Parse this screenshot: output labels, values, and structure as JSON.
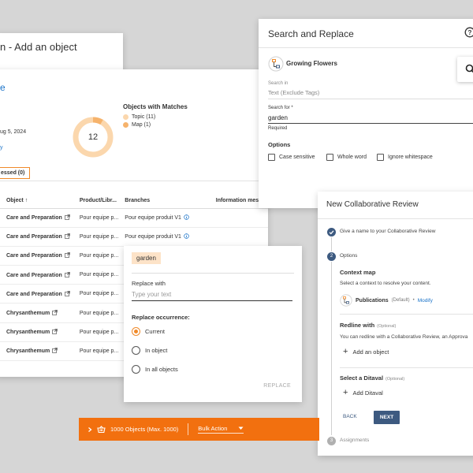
{
  "add_panel": {
    "title": "n - Add an object"
  },
  "table_panel": {
    "crumb": "e",
    "date": "ug 5, 2024",
    "link": "y",
    "objects_with_matches": {
      "title": "Objects with Matches",
      "total": "12",
      "items": [
        {
          "label": "Topic (11)",
          "color": "#fbd7ad",
          "value": 11
        },
        {
          "label": "Map (1)",
          "color": "#f6b36c",
          "value": 1
        }
      ]
    },
    "tab_label": "essed (0)",
    "columns": [
      "Object",
      "Product/Libr...",
      "Branches",
      "Information messa"
    ],
    "rows": [
      {
        "object": "Care and Preparation",
        "product": "Pour equipe p...",
        "branch": "Pour equipe produit V1"
      },
      {
        "object": "Care and Preparation",
        "product": "Pour equipe p...",
        "branch": "Pour equipe produit V1"
      },
      {
        "object": "Care and Preparation",
        "product": "Pour equipe p...",
        "branch": ""
      },
      {
        "object": "Care and Preparation",
        "product": "Pour equipe p...",
        "branch": ""
      },
      {
        "object": "Care and Preparation",
        "product": "Pour equipe p...",
        "branch": ""
      },
      {
        "object": "Chrysanthemum",
        "product": "Pour equipe p...",
        "branch": ""
      },
      {
        "object": "Chrysanthemum",
        "product": "Pour equipe p...",
        "branch": ""
      },
      {
        "object": "Chrysanthemum",
        "product": "Pour equipe p...",
        "branch": ""
      }
    ]
  },
  "search_panel": {
    "title": "Search and Replace",
    "ditamap_name": "Growing Flowers",
    "search_in_label": "Search in",
    "search_in_value": "Text (Exclude Tags)",
    "search_for_label": "Search for *",
    "search_for_value": "garden",
    "required_label": "Required",
    "options_label": "Options",
    "options": [
      "Case sensitive",
      "Whole word",
      "Ignore whitespace"
    ]
  },
  "replace_panel": {
    "chip": "garden",
    "replace_label": "Replace with",
    "replace_placeholder": "Type your text",
    "occurrence_label": "Replace occurrence:",
    "occurrences": [
      "Current",
      "In object",
      "In all objects"
    ],
    "selected": "Current",
    "button": "REPLACE"
  },
  "review_panel": {
    "title": "New Collaborative Review",
    "step1": "Give a name to your Collaborative Review",
    "step2_num": "2",
    "step2": "Options",
    "context_title": "Context map",
    "context_desc": "Select a context to resolve your content.",
    "context_name": "Publications",
    "context_default": "(Default)",
    "context_sep": "•",
    "context_modify": "Modify",
    "redline_title": "Redline with",
    "optional": "(Optional)",
    "redline_desc": "You can redline with a Collaborative Review, an Approva",
    "add_object": "Add an object",
    "ditaval_title": "Select a Ditaval",
    "add_ditaval": "Add Ditaval",
    "back": "BACK",
    "next": "NEXT",
    "step3_num": "3",
    "step3": "Assignments"
  },
  "bulk_bar": {
    "count": "1000 Objects (Max. 1000)",
    "action": "Bulk Action",
    "color": "#f2700f"
  }
}
